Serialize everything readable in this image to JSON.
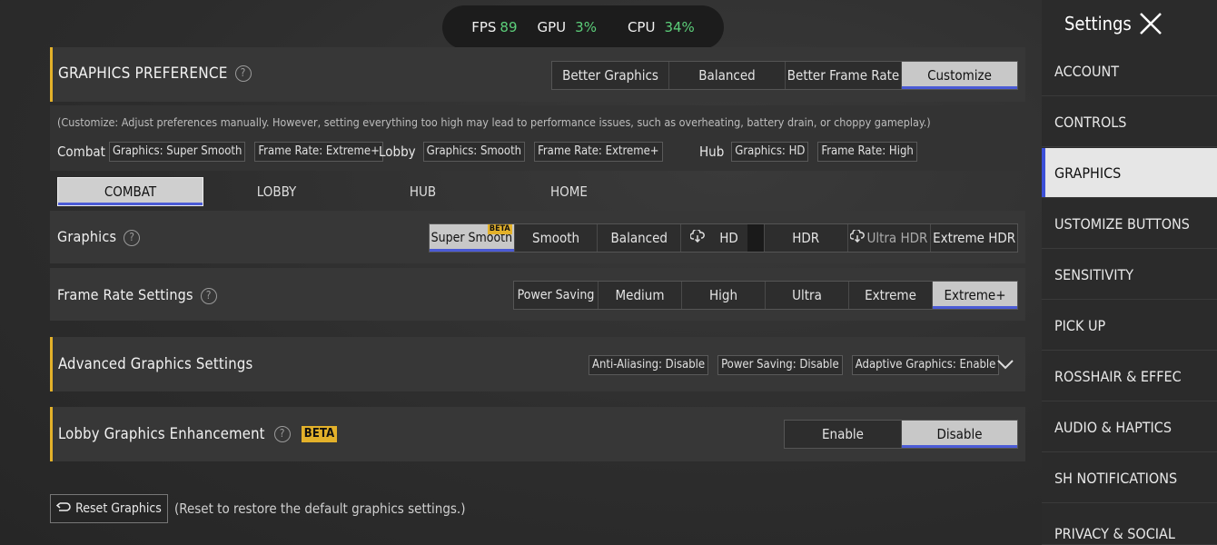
{
  "perf": {
    "fps_label": "FPS",
    "fps": "89",
    "gpu_label": "GPU",
    "gpu": "3%",
    "cpu_label": "CPU",
    "cpu": "34%"
  },
  "preference": {
    "title": "GRAPHICS PREFERENCE",
    "options": [
      "Better Graphics",
      "Balanced",
      "Better Frame Rate",
      "Customize"
    ],
    "selected_index": 3,
    "note": "(Customize: Adjust preferences manually. However, setting everything too high may lead to performance issues, such as overheating, battery drain, or choppy gameplay.)",
    "combat_label": "Combat",
    "combat_graphics": "Graphics: Super Smooth",
    "combat_fps": "Frame Rate: Extreme+",
    "lobby_label": "Lobby",
    "lobby_graphics": "Graphics: Smooth",
    "lobby_fps": "Frame Rate: Extreme+",
    "hub_label": "Hub",
    "hub_graphics": "Graphics: HD",
    "hub_fps": "Frame Rate: High"
  },
  "tabs": [
    "COMBAT",
    "LOBBY",
    "HUB",
    "HOME"
  ],
  "graphics": {
    "label": "Graphics",
    "options": [
      "Super Smooth",
      "Smooth",
      "Balanced",
      "HD",
      "HDR",
      "Ultra HDR",
      "Extreme HDR"
    ],
    "beta": "BETA"
  },
  "framerate": {
    "label": "Frame Rate Settings",
    "options": [
      "Power Saving",
      "Medium",
      "High",
      "Ultra",
      "Extreme",
      "Extreme+"
    ]
  },
  "advanced": {
    "label": "Advanced Graphics Settings",
    "aa": "Anti-Aliasing: Disable",
    "ps": "Power Saving: Disable",
    "ag": "Adaptive Graphics: Enable"
  },
  "lobby_enh": {
    "label": "Lobby Graphics Enhancement",
    "beta": "BETA",
    "enable": "Enable",
    "disable": "Disable"
  },
  "reset": {
    "button": "Reset Graphics",
    "note": "(Reset to restore the default graphics settings.)"
  },
  "sidebar": {
    "title": "Settings",
    "items": [
      "ACCOUNT",
      "CONTROLS",
      "GRAPHICS",
      "USTOMIZE BUTTONS",
      "SENSITIVITY",
      "PICK UP",
      "ROSSHAIR & EFFEC",
      "AUDIO & HAPTICS",
      "SH NOTIFICATIONS",
      "PRIVACY & SOCIAL"
    ]
  },
  "colors": {
    "accent": "#e3b12a",
    "select_underline": "#4b5bd6",
    "value_green": "#5ccf7a"
  }
}
